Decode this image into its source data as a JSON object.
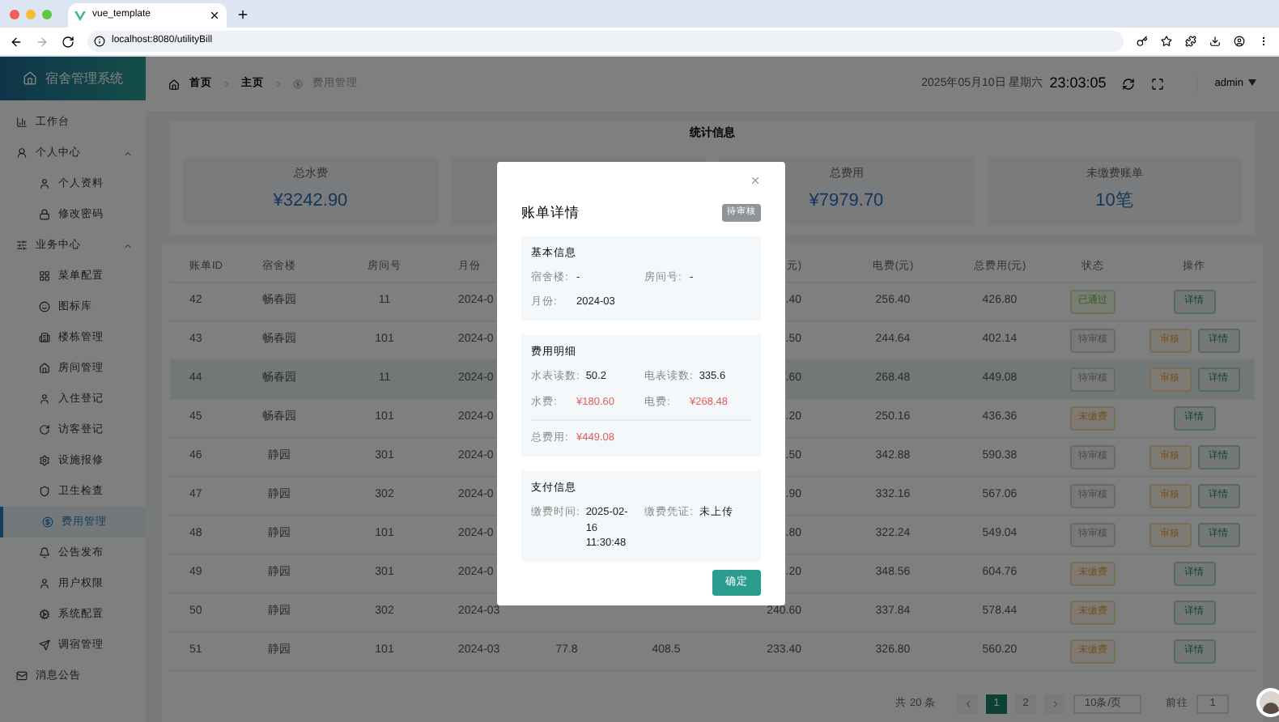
{
  "browser": {
    "tab_title": "vue_template",
    "url": "localhost:8080/utilityBill"
  },
  "sidebar": {
    "logo": "宿舍管理系统",
    "items": [
      {
        "label": "工作台",
        "selected": false
      },
      {
        "label": "个人中心",
        "selected": false,
        "expanded": true,
        "children": [
          {
            "label": "个人资料",
            "selected": false
          },
          {
            "label": "修改密码",
            "selected": false
          }
        ]
      },
      {
        "label": "业务中心",
        "selected": false,
        "expanded": true,
        "children": [
          {
            "label": "菜单配置",
            "selected": false
          },
          {
            "label": "图标库",
            "selected": false
          },
          {
            "label": "楼栋管理",
            "selected": false
          },
          {
            "label": "房间管理",
            "selected": false
          },
          {
            "label": "入住登记",
            "selected": false
          },
          {
            "label": "访客登记",
            "selected": false
          },
          {
            "label": "设施报修",
            "selected": false
          },
          {
            "label": "卫生检查",
            "selected": false
          },
          {
            "label": "费用管理",
            "selected": true
          },
          {
            "label": "公告发布",
            "selected": false
          },
          {
            "label": "用户权限",
            "selected": false
          },
          {
            "label": "系统配置",
            "selected": false
          },
          {
            "label": "调宿管理",
            "selected": false
          }
        ]
      },
      {
        "label": "消息公告",
        "selected": false
      }
    ]
  },
  "header": {
    "breadcrumb": [
      "首页",
      "主页",
      "费用管理"
    ],
    "date": "2025年05月10日 星期六",
    "time": "23:03:05",
    "user": "admin"
  },
  "stats": {
    "title": "统计信息",
    "cards": [
      {
        "kind": "stat",
        "label": "总水费",
        "value": "¥3242.90"
      },
      {
        "kind": "covered"
      },
      {
        "kind": "stat",
        "label": "总费用",
        "value": "¥7979.70"
      },
      {
        "kind": "stat",
        "label": "未缴费账单",
        "value": "10笔"
      }
    ]
  },
  "table": {
    "columns": [
      {
        "label": "账单ID"
      },
      {
        "label": "宿舍楼"
      },
      {
        "label": "房间号"
      },
      {
        "label": "月份"
      },
      {},
      {},
      {
        "label": "元)"
      },
      {
        "label": "电费(元)"
      },
      {
        "label": "总费用(元)"
      },
      {
        "label": "状态"
      },
      {
        "label": "操作"
      }
    ],
    "rows": [
      {
        "id": "42",
        "building": "畅春园",
        "room": "11",
        "month": "2024-0",
        "water_fee": ".40",
        "electric_fee": "256.40",
        "total": "426.80",
        "status": {
          "label": "已通过",
          "kind": "approved"
        },
        "actions": [
          {
            "label": "详情",
            "kind": "detail"
          }
        ],
        "selected": false
      },
      {
        "id": "43",
        "building": "畅春园",
        "room": "101",
        "month": "2024-0",
        "water_fee": ".50",
        "electric_fee": "244.64",
        "total": "402.14",
        "status": {
          "label": "待审核",
          "kind": "pending"
        },
        "actions": [
          {
            "label": "审核",
            "kind": "review"
          },
          {
            "label": "详情",
            "kind": "detail"
          }
        ],
        "selected": false
      },
      {
        "id": "44",
        "building": "畅春园",
        "room": "11",
        "month": "2024-0",
        "water_fee": ".60",
        "electric_fee": "268.48",
        "total": "449.08",
        "status": {
          "label": "待审核",
          "kind": "pending"
        },
        "actions": [
          {
            "label": "审核",
            "kind": "review"
          },
          {
            "label": "详情",
            "kind": "detail"
          }
        ],
        "selected": true
      },
      {
        "id": "45",
        "building": "畅春园",
        "room": "101",
        "month": "2024-0",
        "water_fee": ".20",
        "electric_fee": "250.16",
        "total": "436.36",
        "status": {
          "label": "未缴费",
          "kind": "unpaid"
        },
        "actions": [
          {
            "label": "详情",
            "kind": "detail"
          }
        ],
        "selected": false
      },
      {
        "id": "46",
        "building": "静园",
        "room": "301",
        "month": "2024-0",
        "water_fee": ".50",
        "electric_fee": "342.88",
        "total": "590.38",
        "status": {
          "label": "待审核",
          "kind": "pending"
        },
        "actions": [
          {
            "label": "审核",
            "kind": "review"
          },
          {
            "label": "详情",
            "kind": "detail"
          }
        ],
        "selected": false
      },
      {
        "id": "47",
        "building": "静园",
        "room": "302",
        "month": "2024-0",
        "water_fee": ".90",
        "electric_fee": "332.16",
        "total": "567.06",
        "status": {
          "label": "待审核",
          "kind": "pending"
        },
        "actions": [
          {
            "label": "审核",
            "kind": "review"
          },
          {
            "label": "详情",
            "kind": "detail"
          }
        ],
        "selected": false
      },
      {
        "id": "48",
        "building": "静园",
        "room": "101",
        "month": "2024-0",
        "water_fee": ".80",
        "electric_fee": "322.24",
        "total": "549.04",
        "status": {
          "label": "待审核",
          "kind": "pending"
        },
        "actions": [
          {
            "label": "审核",
            "kind": "review"
          },
          {
            "label": "详情",
            "kind": "detail"
          }
        ],
        "selected": false
      },
      {
        "id": "49",
        "building": "静园",
        "room": "301",
        "month": "2024-0",
        "water_fee": ".20",
        "electric_fee": "348.56",
        "total": "604.76",
        "status": {
          "label": "未缴费",
          "kind": "unpaid"
        },
        "actions": [
          {
            "label": "详情",
            "kind": "detail"
          }
        ],
        "selected": false
      },
      {
        "id": "50",
        "building": "静园",
        "room": "302",
        "month": "2024-03",
        "water_fee": "240.60",
        "electric_fee": "337.84",
        "total": "578.44",
        "status": {
          "label": "未缴费",
          "kind": "unpaid"
        },
        "actions": [
          {
            "label": "详情",
            "kind": "detail"
          }
        ],
        "selected": false
      },
      {
        "id": "51",
        "building": "静园",
        "room": "101",
        "month": "2024-03",
        "column_5": "77.8",
        "column_6": "408.5",
        "water_fee": "233.40",
        "electric_fee": "326.80",
        "total": "560.20",
        "status": {
          "label": "未缴费",
          "kind": "unpaid"
        },
        "actions": [
          {
            "label": "详情",
            "kind": "detail"
          }
        ],
        "selected": false
      }
    ]
  },
  "pagination": {
    "total": "共 20 条",
    "pages": [
      {
        "label": "1",
        "selected": true
      },
      {
        "label": "2",
        "selected": false
      }
    ],
    "page_size": "10条/页",
    "goto_label": "前往",
    "goto_value": "1"
  },
  "dialog": {
    "title": "账单详情",
    "badge": "待审核",
    "sections": [
      {
        "title": "基本信息",
        "fields": [
          {
            "label": "宿舍楼:",
            "value": "-",
            "highlight": false
          },
          {
            "label": "房间号:",
            "value": "-",
            "highlight": false
          },
          {
            "label": "月份:",
            "value": "2024-03",
            "highlight": false
          }
        ]
      },
      {
        "title": "费用明细",
        "fields": [
          {
            "label": "水表读数:",
            "value": "50.2",
            "highlight": false
          },
          {
            "label": "电表读数:",
            "value": "335.6",
            "highlight": false
          },
          {
            "label": "水费:",
            "value": "¥180.60",
            "highlight": true
          },
          {
            "label": "电费:",
            "value": "¥268.48",
            "highlight": true
          }
        ],
        "total": {
          "label": "总费用:",
          "value": "¥449.08"
        }
      },
      {
        "title": "支付信息",
        "fields": [
          {
            "label": "缴费时间:",
            "value": "2025-02-16 11:30:48",
            "highlight": false
          },
          {
            "label": "缴费凭证:",
            "value": "未上传",
            "highlight": false
          }
        ]
      }
    ],
    "button": "确定"
  }
}
